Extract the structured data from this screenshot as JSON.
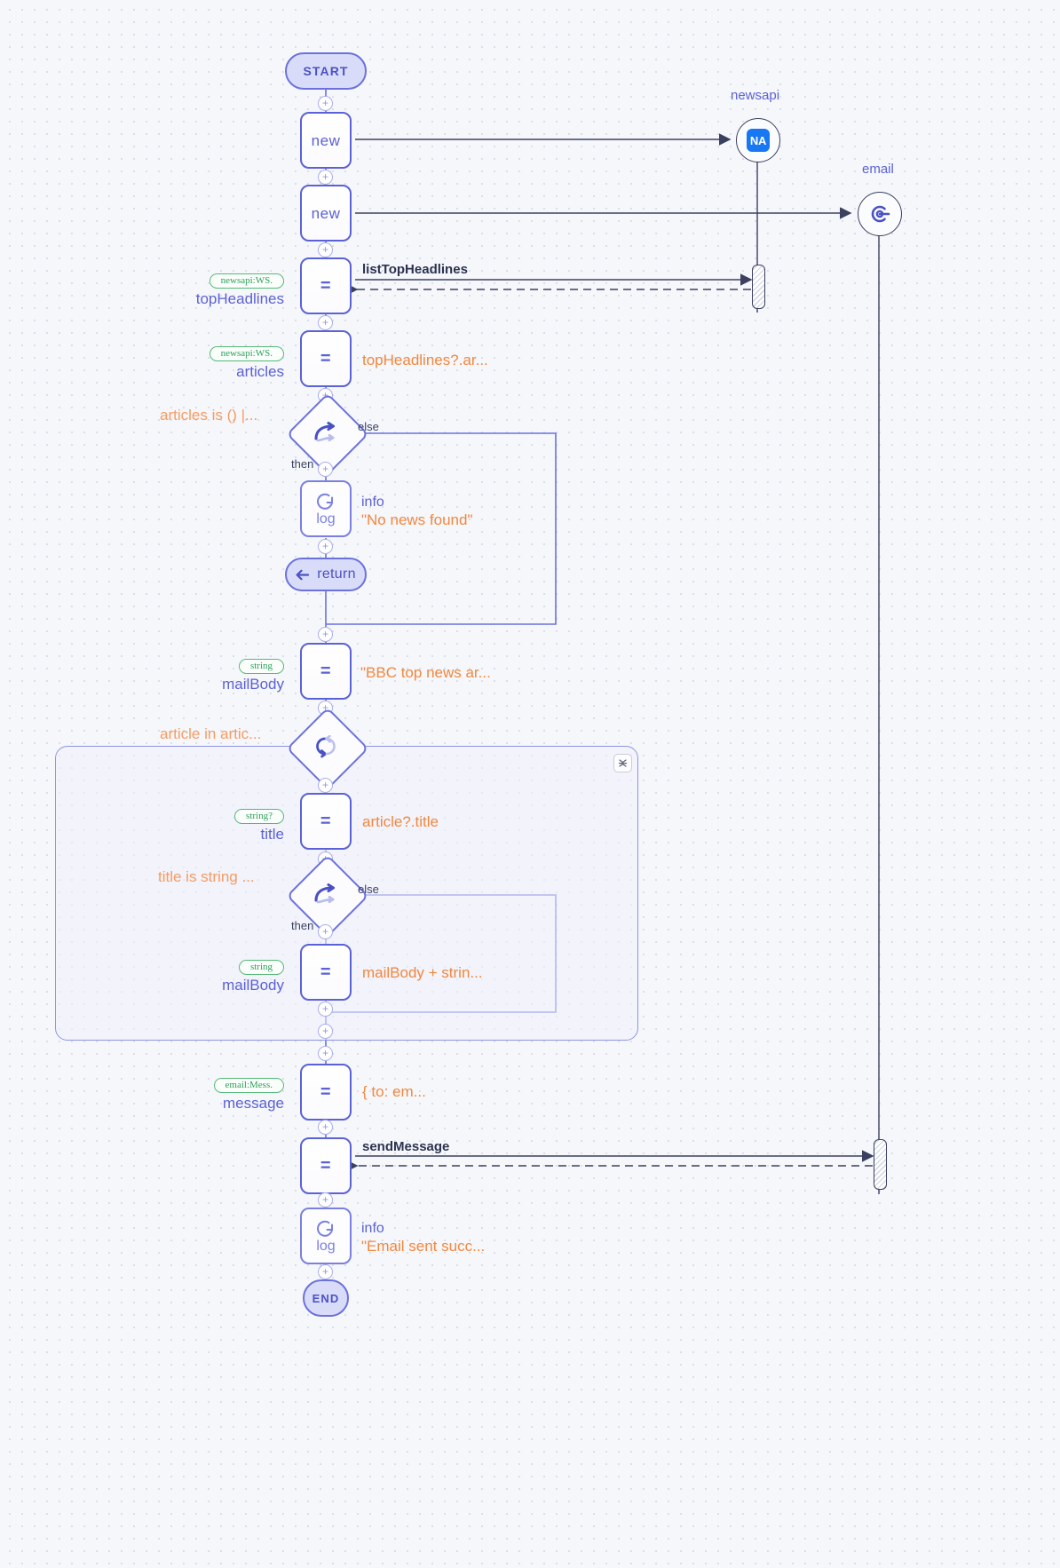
{
  "canvas": {
    "title": "workflow-editor-canvas",
    "accent_indigo": "#5b61d6",
    "accent_orange": "#f2873e",
    "accent_green": "#2e9e5b",
    "background": "#f6f7fb"
  },
  "participants": [
    {
      "name": "newsapi",
      "icon": "newsapi-icon",
      "icon_text": "NA"
    },
    {
      "name": "email",
      "icon": "email-connector-icon",
      "icon_text": ""
    }
  ],
  "terminals": {
    "start": "START",
    "end": "END",
    "return": "return"
  },
  "branch_labels": {
    "then": "then",
    "else": "else"
  },
  "nodes": [
    {
      "id": "new1",
      "glyph": "new",
      "kind": "constructor"
    },
    {
      "id": "new2",
      "glyph": "new",
      "kind": "constructor"
    },
    {
      "id": "topHeadlines",
      "glyph": "=",
      "kind": "assignment",
      "type_badge": "newsapi:WS.",
      "var_name": "topHeadlines",
      "call_label": "listTopHeadlines"
    },
    {
      "id": "articles",
      "glyph": "=",
      "kind": "assignment",
      "type_badge": "newsapi:WS.",
      "var_name": "articles",
      "expression": "topHeadlines?.ar..."
    },
    {
      "id": "if1",
      "kind": "branch",
      "condition": "articles is () |..."
    },
    {
      "id": "log1",
      "kind": "log",
      "glyph": "log",
      "level": "info",
      "message": "\"No news found\""
    },
    {
      "id": "return1",
      "kind": "return",
      "label": "return"
    },
    {
      "id": "mailBody1",
      "glyph": "=",
      "kind": "assignment",
      "type_badge": "string",
      "var_name": "mailBody",
      "expression": "\"BBC top news ar..."
    },
    {
      "id": "loop1",
      "kind": "loop",
      "condition": "article in artic..."
    },
    {
      "id": "title",
      "glyph": "=",
      "kind": "assignment",
      "type_badge": "string?",
      "var_name": "title",
      "expression": "article?.title"
    },
    {
      "id": "if2",
      "kind": "branch",
      "condition": "title is string ..."
    },
    {
      "id": "mailBody2",
      "glyph": "=",
      "kind": "assignment",
      "type_badge": "string",
      "var_name": "mailBody",
      "expression": "mailBody + strin..."
    },
    {
      "id": "message",
      "glyph": "=",
      "kind": "assignment",
      "type_badge": "email:Mess.",
      "var_name": "message",
      "expression": "{ to: em..."
    },
    {
      "id": "sendMessage",
      "glyph": "=",
      "kind": "assignment",
      "call_label": "sendMessage"
    },
    {
      "id": "log2",
      "kind": "log",
      "glyph": "log",
      "level": "info",
      "message": "\"Email sent succ..."
    }
  ],
  "plus_connector_label": "+"
}
